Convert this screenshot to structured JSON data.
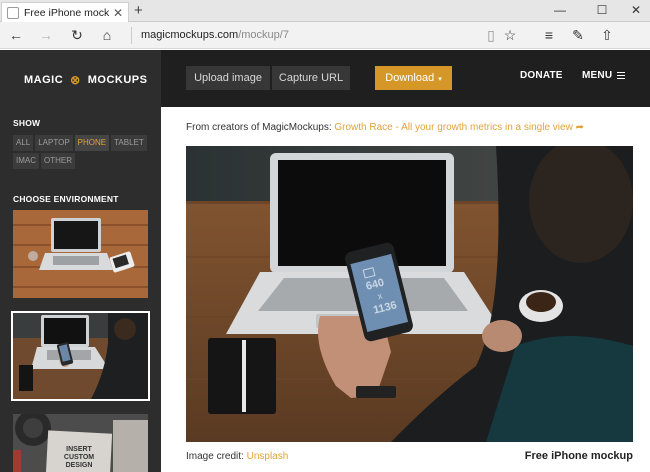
{
  "browser": {
    "tab_title": "Free iPhone mockup - M",
    "tab_close": "✕",
    "new_tab": "+",
    "window_controls": {
      "minimize": "—",
      "maximize": "☐",
      "close": "✕"
    },
    "address": {
      "host": "magicmockups.com",
      "path": "/mockup/7"
    },
    "icons": {
      "back": "←",
      "forward": "→",
      "refresh": "↻",
      "home": "⌂",
      "reading_view": "▯",
      "favorite": "☆",
      "hub": "≡",
      "notes": "✎",
      "share": "⇧"
    }
  },
  "brand": {
    "name_left": "MAGIC",
    "name_right": "MOCKUPS",
    "mark": "⊗"
  },
  "sidebar": {
    "show_label": "SHOW",
    "filters": [
      {
        "label": "ALL",
        "active": false
      },
      {
        "label": "LAPTOP",
        "active": false
      },
      {
        "label": "PHONE",
        "active": true
      },
      {
        "label": "TABLET",
        "active": false
      },
      {
        "label": "IMAC",
        "active": false
      },
      {
        "label": "OTHER",
        "active": false
      }
    ],
    "env_label": "CHOOSE ENVIRONMENT",
    "thumb_text": "INSERT\nCUSTOM\nDESIGN"
  },
  "topbar": {
    "upload": "Upload image",
    "capture": "Capture URL",
    "download": "Download",
    "download_caret": "▾",
    "donate": "DONATE",
    "menu": "MENU"
  },
  "main": {
    "promo_prefix": "From creators of MagicMockups:",
    "promo_link": "Growth Race - All your growth metrics in a single view",
    "promo_arrow": "➦",
    "credit_prefix": "Image credit:",
    "credit_link": "Unsplash",
    "caption": "Free iPhone mockup",
    "screen_line1": "640",
    "screen_x": "x",
    "screen_line2": "1136"
  },
  "colors": {
    "accent": "#d69729",
    "sidebar_bg": "#2d2d2d",
    "topbar_bg": "#1f1f1f"
  }
}
